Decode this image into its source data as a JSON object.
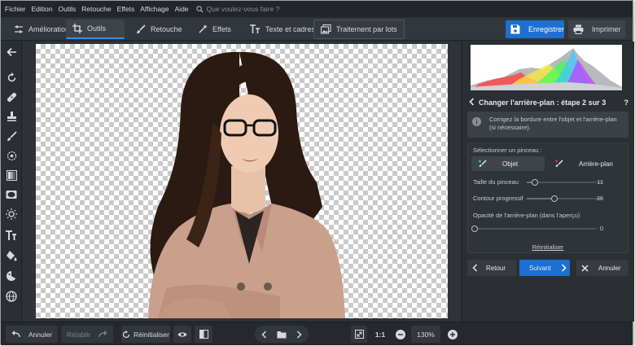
{
  "menu": {
    "items": [
      "Fichier",
      "Edition",
      "Outils",
      "Retouche",
      "Effets",
      "Affichage",
      "Aide"
    ],
    "search_placeholder": "Que voulez-vous faire ?"
  },
  "tabs": [
    {
      "label": "Amélioration",
      "icon": "sliders-icon"
    },
    {
      "label": "Outils",
      "icon": "crop-icon",
      "active": true
    },
    {
      "label": "Retouche",
      "icon": "brush-icon"
    },
    {
      "label": "Effets",
      "icon": "magic-wand-icon"
    },
    {
      "label": "Texte et cadres",
      "icon": "text-icon"
    },
    {
      "label": "Traitement par lots",
      "icon": "images-icon"
    }
  ],
  "actions": {
    "save_label": "Enregistrer",
    "print_label": "Imprimer"
  },
  "colors": {
    "accent": "#1d6fd1",
    "panel": "#2b2f34",
    "checker": "#c9c9c9"
  },
  "left_tools": [
    "back-arrow-icon",
    "rotate-icon",
    "healing-icon",
    "stamp-icon",
    "pen-icon",
    "target-icon",
    "gradient-icon",
    "vignette-icon",
    "sun-icon",
    "text-icon",
    "fill-icon",
    "color-picker-icon",
    "globe-icon"
  ],
  "bottom": {
    "undo_label": "Annuler",
    "redo_label": "Rétablir",
    "reset_label": "Réinitialiser",
    "ratio_label": "1:1",
    "zoom_label": "130%"
  },
  "panel": {
    "step_title": "Changer l'arrière-plan : étape 2 sur 3",
    "help": "?",
    "info_text": "Corrigez la bordure entre l'objet et l'arrière-plan (si nécessaire).",
    "brush_label": "Sélectionner un pinceau :",
    "brush_object": "Objet",
    "brush_background": "Arrière-plan",
    "brush_size_label": "Taille du pinceau",
    "brush_size_value": "11",
    "brush_size_fraction": 0.11,
    "contour_label": "Contour progressif",
    "contour_value": "36",
    "contour_fraction": 0.36,
    "opacity_label": "Opacité de l'arrière-plan (dans l'aperçu)",
    "opacity_value": "0",
    "opacity_fraction": 0.0,
    "reset_link": "Réinitialiser",
    "back_label": "Retour",
    "next_label": "Suivant",
    "cancel_label": "Annuler"
  }
}
